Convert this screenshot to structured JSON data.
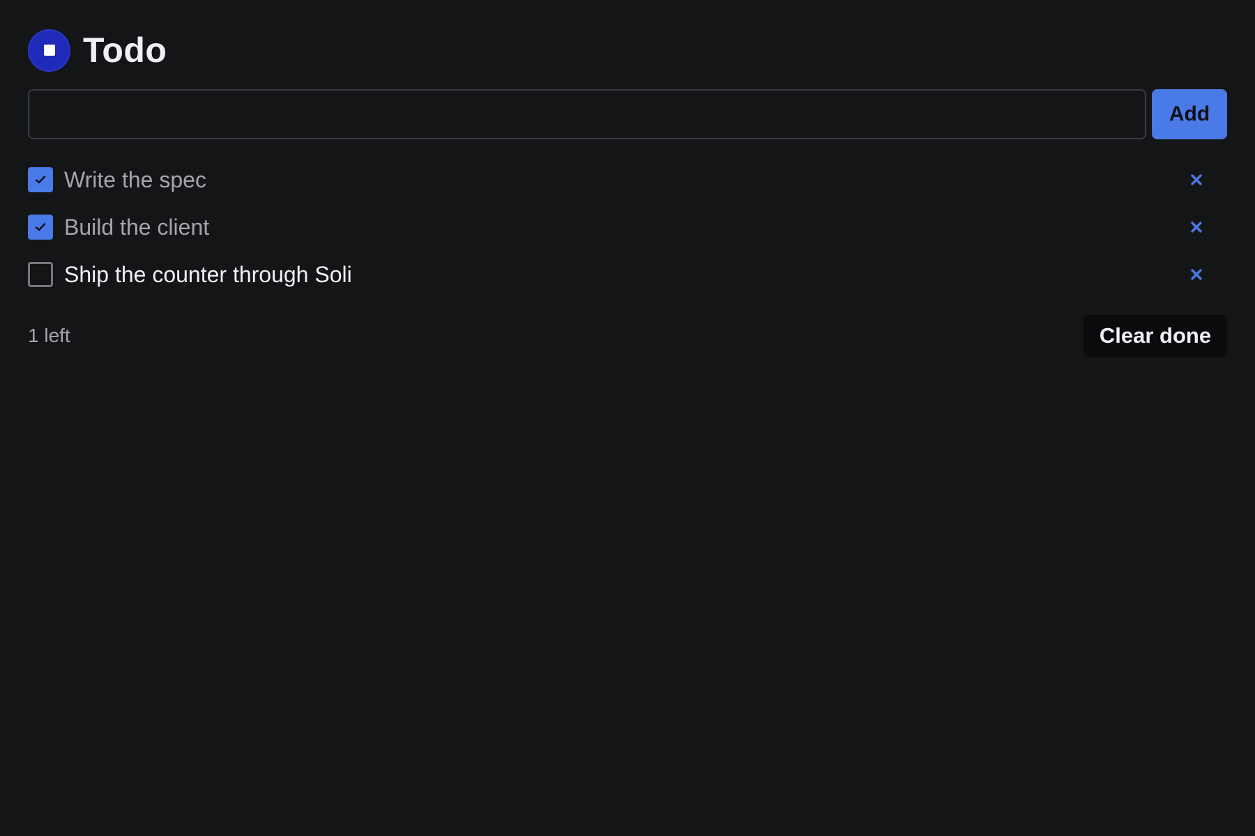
{
  "app": {
    "title": "Todo",
    "logo_icon": "stop-square-icon",
    "accent_color": "#4a7ae8"
  },
  "add_form": {
    "input_value": "",
    "input_placeholder": "",
    "add_label": "Add"
  },
  "todos": [
    {
      "text": "Write the spec",
      "done": true,
      "delete_icon": "close-icon"
    },
    {
      "text": "Build the client",
      "done": true,
      "delete_icon": "close-icon"
    },
    {
      "text": "Ship the counter through Soli",
      "done": false,
      "delete_icon": "close-icon"
    }
  ],
  "footer": {
    "count_label": "1 left",
    "clear_label": "Clear done"
  }
}
